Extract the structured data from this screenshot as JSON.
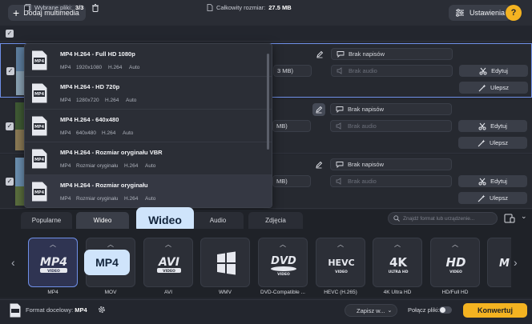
{
  "toolbar": {
    "add_media_label": "Dodaj multimedia",
    "settings_label": "Ustawienia",
    "help_label": "?"
  },
  "selection": {
    "selected_label": "Wybrane pliki:",
    "selected_value": "3/3",
    "total_size_label": "Całkowity rozmiar:",
    "total_size_value": "27.5 MB"
  },
  "files": [
    {
      "size_fragment": "3 MB)",
      "subtitles": "Brak napisów",
      "audio": "Brak audio",
      "edit_label": "Edytuj",
      "enhance_label": "Ulepsz",
      "thumb_colors": [
        "#5e7fa0",
        "#8aa2b4"
      ]
    },
    {
      "size_fragment": "MB)",
      "subtitles": "Brak napisów",
      "audio": "Brak audio",
      "edit_label": "Edytuj",
      "enhance_label": "Ulepsz",
      "thumb_colors": [
        "#3f5a34",
        "#8b7a55"
      ]
    },
    {
      "size_fragment": "MB)",
      "subtitles": "Brak napisów",
      "audio": "Brak audio",
      "edit_label": "Edytuj",
      "enhance_label": "Ulepsz",
      "thumb_colors": [
        "#6b8fb0",
        "#5a6e3e"
      ]
    }
  ],
  "preset_dropdown": {
    "items": [
      {
        "title": "MP4 H.264 - Full HD 1080p",
        "container": "MP4",
        "resolution": "1920x1080",
        "codec": "H.264",
        "fps": "Auto",
        "badge": "HD"
      },
      {
        "title": "MP4 H.264 - HD 720p",
        "container": "MP4",
        "resolution": "1280x720",
        "codec": "H.264",
        "fps": "Auto",
        "badge": ""
      },
      {
        "title": "MP4 H.264 - 640x480",
        "container": "MP4",
        "resolution": "640x480",
        "codec": "H.264",
        "fps": "Auto",
        "badge": ""
      },
      {
        "title": "MP4 H.264 - Rozmiar oryginału VBR",
        "container": "MP4",
        "resolution": "Rozmiar oryginału",
        "codec": "H.264",
        "fps": "Auto",
        "badge": "VBR"
      },
      {
        "title": "MP4 H.264 - Rozmiar oryginału",
        "container": "MP4",
        "resolution": "Rozmiar oryginału",
        "codec": "H.264",
        "fps": "Auto",
        "badge": ""
      }
    ]
  },
  "tabs": {
    "popular": "Popularne",
    "video": "Wideo",
    "audio": "Audio",
    "images": "Zdjęcia",
    "search_placeholder": "Znajdź format lub urządzenie..."
  },
  "callouts": {
    "video_tab": "Wideo",
    "mp4_format": "MP4"
  },
  "formats": [
    {
      "label": "MP4",
      "logo": "MP4",
      "sub": "VIDEO"
    },
    {
      "label": "MOV",
      "logo": "",
      "sub": ""
    },
    {
      "label": "AVI",
      "logo": "AVI",
      "sub": "VIDEO"
    },
    {
      "label": "WMV",
      "logo": "",
      "sub": ""
    },
    {
      "label": "DVD-Compatible ...",
      "logo": "DVD",
      "sub": "VIDEO"
    },
    {
      "label": "HEVC (H.265)",
      "logo": "HEVC",
      "sub": "VIDEO"
    },
    {
      "label": "4K Ultra HD",
      "logo": "4K",
      "sub": "ULTRA HD"
    },
    {
      "label": "HD/Full HD",
      "logo": "HD",
      "sub": "VIDEO"
    },
    {
      "label": "",
      "logo": "M",
      "sub": ""
    }
  ],
  "bottom": {
    "target_format_label": "Format docelowy:",
    "target_format_value": "MP4",
    "save_label": "Zapisz w...",
    "merge_label": "Połącz pliki:",
    "convert_label": "Konwertuj"
  },
  "colors": {
    "accent": "#f4b321",
    "callout_bg": "#cfe4fb",
    "active_format_border": "#6f8fe8"
  }
}
